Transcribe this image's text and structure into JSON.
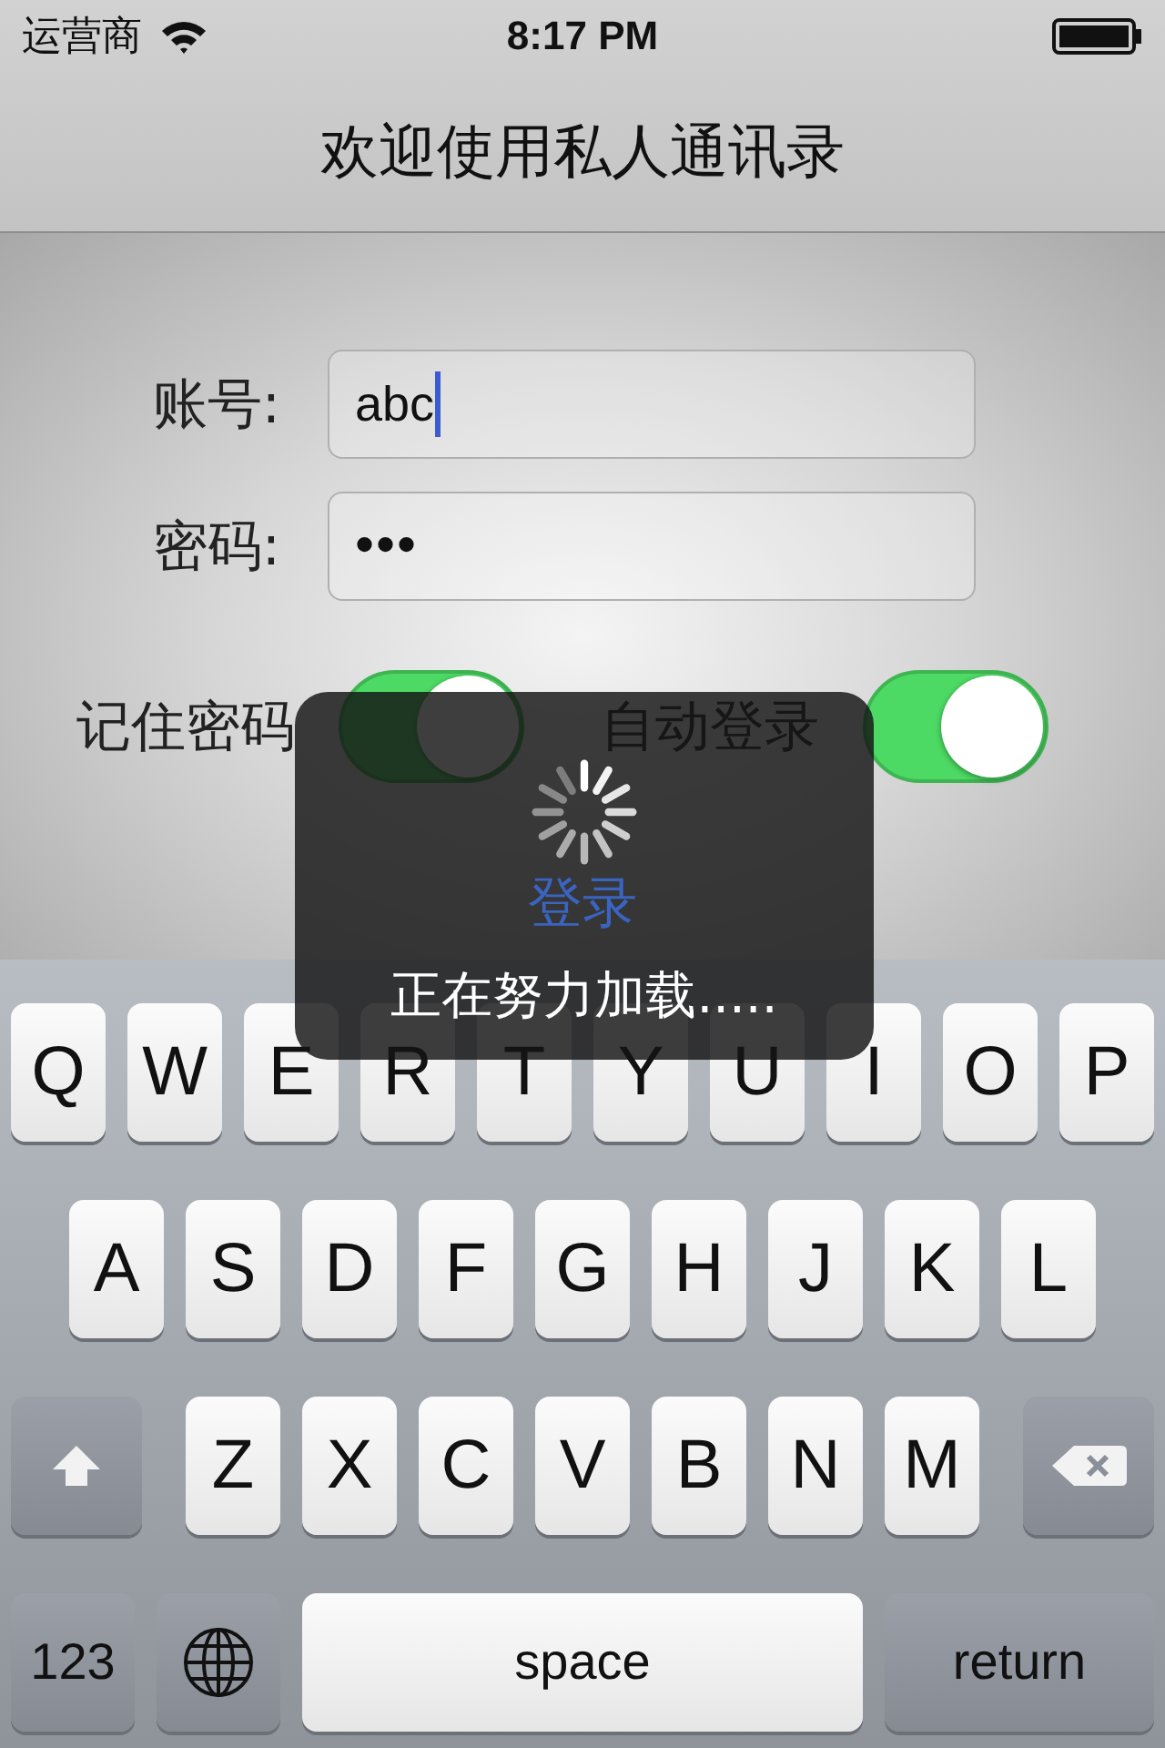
{
  "status_bar": {
    "carrier": "运营商",
    "time": "8:17 PM"
  },
  "nav": {
    "title": "欢迎使用私人通讯录"
  },
  "fields": [
    {
      "label": "账号:",
      "value": "abc",
      "focused": true
    },
    {
      "label": "密码:",
      "value": "•••",
      "focused": false
    }
  ],
  "toggles": [
    {
      "label": "记住密码",
      "on": true
    },
    {
      "label": "自动登录",
      "on": true
    }
  ],
  "login_button": "登录",
  "hud": {
    "message": "正在努力加载....."
  },
  "keyboard": {
    "rows": [
      [
        {
          "kind": "letter",
          "label": "Q"
        },
        {
          "kind": "letter",
          "label": "W"
        },
        {
          "kind": "letter",
          "label": "E"
        },
        {
          "kind": "letter",
          "label": "R"
        },
        {
          "kind": "letter",
          "label": "T"
        },
        {
          "kind": "letter",
          "label": "Y"
        },
        {
          "kind": "letter",
          "label": "U"
        },
        {
          "kind": "letter",
          "label": "I"
        },
        {
          "kind": "letter",
          "label": "O"
        },
        {
          "kind": "letter",
          "label": "P"
        }
      ],
      [
        {
          "kind": "letter",
          "label": "A"
        },
        {
          "kind": "letter",
          "label": "S"
        },
        {
          "kind": "letter",
          "label": "D"
        },
        {
          "kind": "letter",
          "label": "F"
        },
        {
          "kind": "letter",
          "label": "G"
        },
        {
          "kind": "letter",
          "label": "H"
        },
        {
          "kind": "letter",
          "label": "J"
        },
        {
          "kind": "letter",
          "label": "K"
        },
        {
          "kind": "letter",
          "label": "L"
        }
      ],
      [
        {
          "kind": "shift"
        },
        {
          "kind": "letter",
          "label": "Z"
        },
        {
          "kind": "letter",
          "label": "X"
        },
        {
          "kind": "letter",
          "label": "C"
        },
        {
          "kind": "letter",
          "label": "V"
        },
        {
          "kind": "letter",
          "label": "B"
        },
        {
          "kind": "letter",
          "label": "N"
        },
        {
          "kind": "letter",
          "label": "M"
        },
        {
          "kind": "backspace"
        }
      ]
    ],
    "bottom_bar": [
      {
        "kind": "numbers",
        "label": "123"
      },
      {
        "kind": "globe"
      },
      {
        "kind": "space",
        "label": "space"
      },
      {
        "kind": "return",
        "label": "return"
      }
    ]
  }
}
